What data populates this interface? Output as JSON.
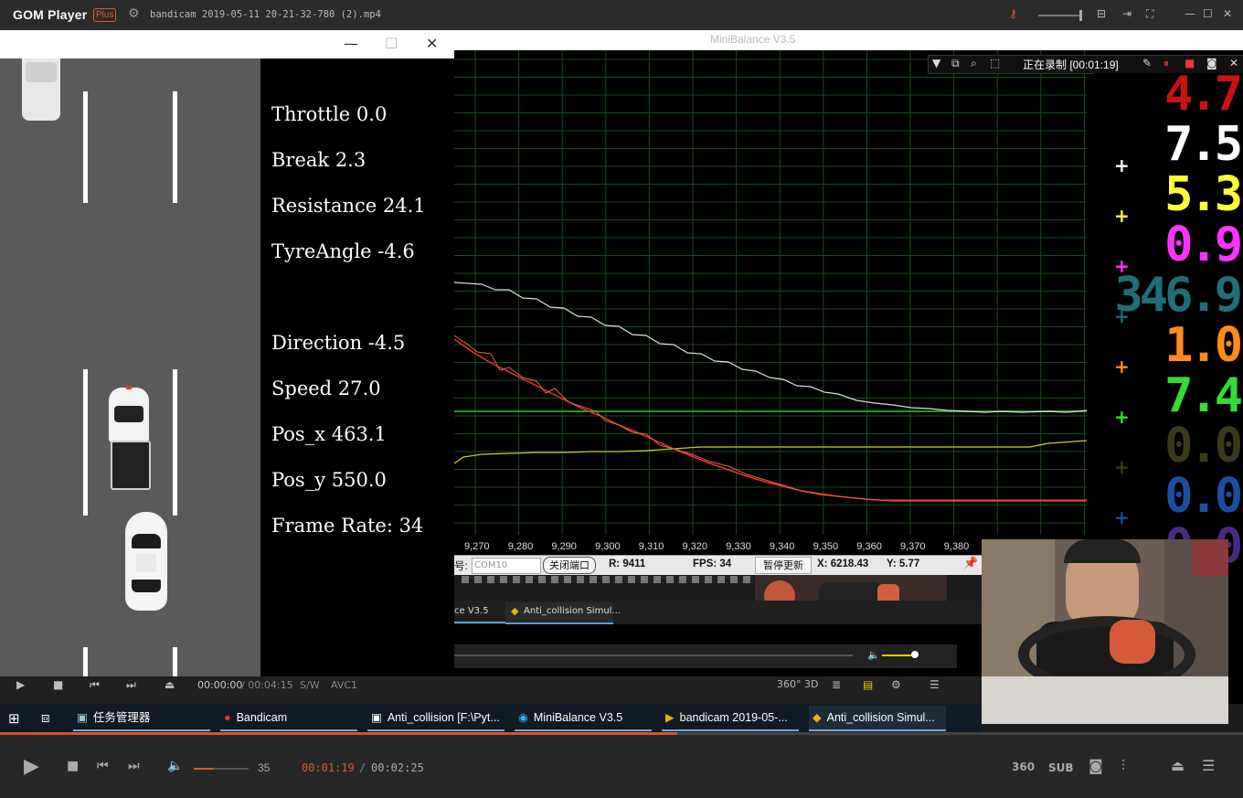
{
  "player": {
    "app_name": "GOM Player",
    "plus_badge": "Plus",
    "filename": "bandicam 2019-05-11 20-21-32-780 (2).mp4",
    "volume": "35",
    "volume_level": 0.35,
    "time_current": "00:01:19",
    "time_sep": "/",
    "time_total": "00:02:25",
    "progress": 0.545,
    "sub_label": "SUB",
    "label_360": "360",
    "accent_color": "#e05a2a"
  },
  "minibalance": {
    "title": "MiniBalance V3.5",
    "recording": "正在录制 [00:01:19]",
    "x_ticks": [
      "9,270",
      "9,280",
      "9,290",
      "9,300",
      "9,310",
      "9,320",
      "9,330",
      "9,340",
      "9,350",
      "9,360",
      "9,370",
      "9,380"
    ],
    "status": {
      "port_prefix": "号:",
      "com": "COM10",
      "close_port": "关闭端口",
      "r": "R:  9411",
      "fps": "FPS:  34",
      "pause": "暂停更新",
      "x": "X:  6218.43",
      "y": "Y:  5.77"
    },
    "digits": [
      {
        "value": "4.7",
        "color": "#cc1111"
      },
      {
        "value": "7.5",
        "color": "#ffffff"
      },
      {
        "value": "5.3",
        "color": "#ffff33"
      },
      {
        "value": "0.9",
        "color": "#ff33ff"
      },
      {
        "value": "346.9",
        "color": "#1f6e7a"
      },
      {
        "value": "1.0",
        "color": "#ff8c1a"
      },
      {
        "value": "7.4",
        "color": "#33dd33"
      },
      {
        "value": "0.0",
        "color": "#3a3a1a"
      },
      {
        "value": "0.0",
        "color": "#1a4fa0"
      },
      {
        "value": "0.0",
        "color": "#4a2a80"
      }
    ]
  },
  "simulator": {
    "info": [
      {
        "label": "Throttle 0.0"
      },
      {
        "label": "Break 2.3"
      },
      {
        "label": "Resistance 24.1"
      },
      {
        "label": "TyreAngle -4.6"
      },
      {
        "label": "Direction -4.5"
      },
      {
        "label": "Speed 27.0"
      },
      {
        "label": "Pos_x 463.1"
      },
      {
        "label": "Pos_y 550.0"
      },
      {
        "label": "Frame Rate: 34"
      }
    ]
  },
  "inner_player": {
    "time": "00:00:00",
    "total": "/ 00:04:15",
    "sw": "S/W",
    "codec": "AVC1",
    "tab1": "ce V3.5",
    "tab2": "Anti_collision Simul..."
  },
  "taskbar": {
    "items": [
      {
        "label": "任务管理器"
      },
      {
        "label": "Bandicam"
      },
      {
        "label": "Anti_collision [F:\\Pyt..."
      },
      {
        "label": "MiniBalance V3.5"
      },
      {
        "label": "bandicam 2019-05-..."
      },
      {
        "label": "Anti_collision Simul..."
      }
    ]
  }
}
